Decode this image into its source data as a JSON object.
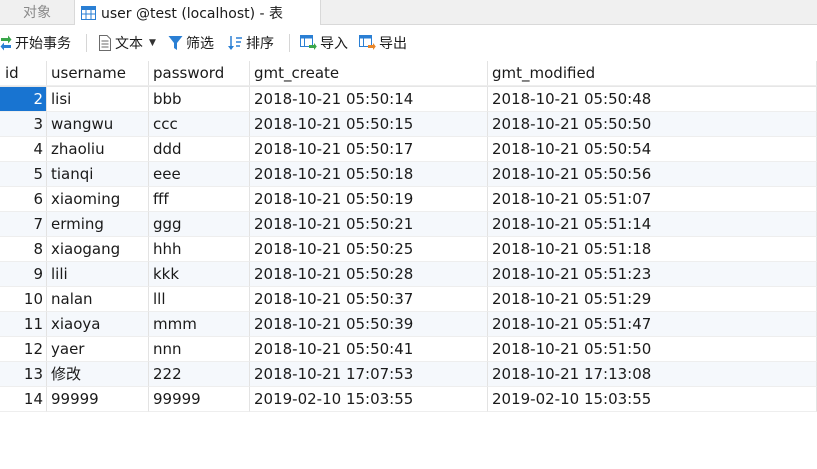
{
  "tabs": {
    "objects_label": "对象",
    "active_label": "user @test (localhost) - 表"
  },
  "toolbar": {
    "begin_transaction": "开始事务",
    "text": "文本",
    "filter": "筛选",
    "sort": "排序",
    "import": "导入",
    "export": "导出"
  },
  "columns": [
    "id",
    "username",
    "password",
    "gmt_create",
    "gmt_modified"
  ],
  "rows": [
    {
      "id": "2",
      "username": "lisi",
      "password": "bbb",
      "gmt_create": "2018-10-21 05:50:14",
      "gmt_modified": "2018-10-21 05:50:48"
    },
    {
      "id": "3",
      "username": "wangwu",
      "password": "ccc",
      "gmt_create": "2018-10-21 05:50:15",
      "gmt_modified": "2018-10-21 05:50:50"
    },
    {
      "id": "4",
      "username": "zhaoliu",
      "password": "ddd",
      "gmt_create": "2018-10-21 05:50:17",
      "gmt_modified": "2018-10-21 05:50:54"
    },
    {
      "id": "5",
      "username": "tianqi",
      "password": "eee",
      "gmt_create": "2018-10-21 05:50:18",
      "gmt_modified": "2018-10-21 05:50:56"
    },
    {
      "id": "6",
      "username": "xiaoming",
      "password": "fff",
      "gmt_create": "2018-10-21 05:50:19",
      "gmt_modified": "2018-10-21 05:51:07"
    },
    {
      "id": "7",
      "username": "erming",
      "password": "ggg",
      "gmt_create": "2018-10-21 05:50:21",
      "gmt_modified": "2018-10-21 05:51:14"
    },
    {
      "id": "8",
      "username": "xiaogang",
      "password": "hhh",
      "gmt_create": "2018-10-21 05:50:25",
      "gmt_modified": "2018-10-21 05:51:18"
    },
    {
      "id": "9",
      "username": "lili",
      "password": "kkk",
      "gmt_create": "2018-10-21 05:50:28",
      "gmt_modified": "2018-10-21 05:51:23"
    },
    {
      "id": "10",
      "username": "nalan",
      "password": "lll",
      "gmt_create": "2018-10-21 05:50:37",
      "gmt_modified": "2018-10-21 05:51:29"
    },
    {
      "id": "11",
      "username": "xiaoya",
      "password": "mmm",
      "gmt_create": "2018-10-21 05:50:39",
      "gmt_modified": "2018-10-21 05:51:47"
    },
    {
      "id": "12",
      "username": "yaer",
      "password": "nnn",
      "gmt_create": "2018-10-21 05:50:41",
      "gmt_modified": "2018-10-21 05:51:50"
    },
    {
      "id": "13",
      "username": "修改",
      "password": "222",
      "gmt_create": "2018-10-21 17:07:53",
      "gmt_modified": "2018-10-21 17:13:08"
    },
    {
      "id": "14",
      "username": "99999",
      "password": "99999",
      "gmt_create": "2019-02-10 15:03:55",
      "gmt_modified": "2019-02-10 15:03:55"
    }
  ],
  "selected_row_index": 0,
  "icons": {
    "table": "table-icon",
    "begin_transaction": "transaction-icon",
    "text": "document-icon",
    "filter": "funnel-icon",
    "sort": "sort-icon",
    "import": "import-icon",
    "export": "export-icon"
  },
  "colors": {
    "selection": "#1874d1",
    "alt_row": "#f5f8fc",
    "icon_blue": "#2a7fd4"
  }
}
